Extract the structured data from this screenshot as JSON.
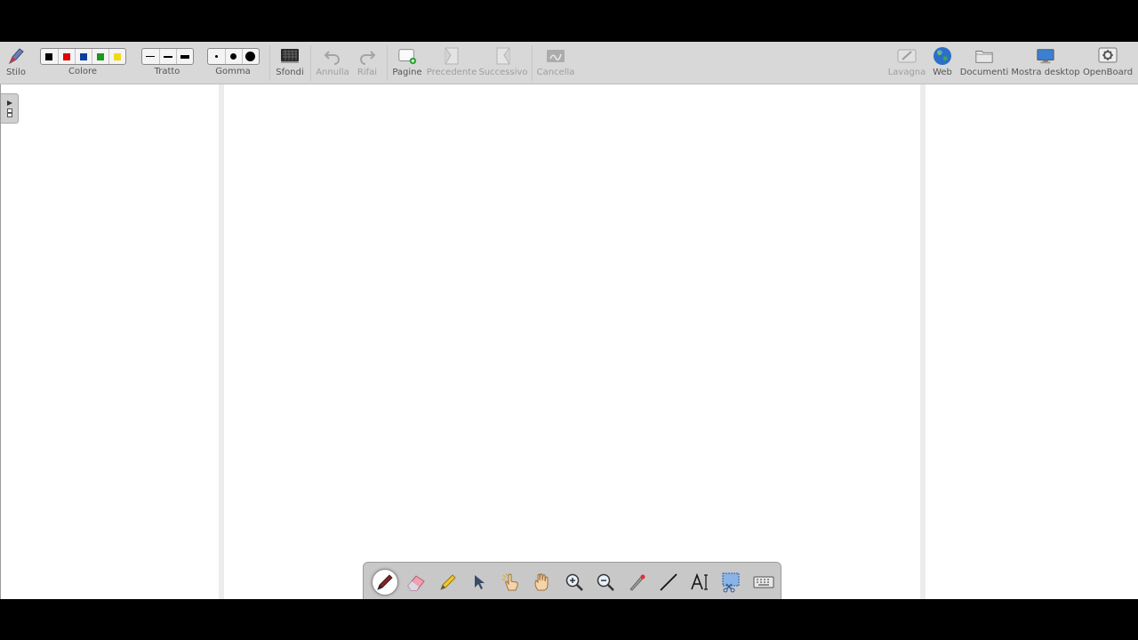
{
  "toolbar": {
    "stylus_label": "Stilo",
    "color_label": "Colore",
    "colors": [
      "#000000",
      "#e00000",
      "#0a3fa0",
      "#1a9a1a",
      "#f2d81a"
    ],
    "stroke_label": "Tratto",
    "eraser_label": "Gomma",
    "backgrounds_label": "Sfondi",
    "undo_label": "Annulla",
    "redo_label": "Rifai",
    "pages_label": "Pagine",
    "previous_label": "Precedente",
    "next_label": "Successivo",
    "clear_label": "Cancella",
    "board_label": "Lavagna",
    "web_label": "Web",
    "documents_label": "Documenti",
    "show_desktop_label": "Mostra desktop",
    "openboard_label": "OpenBoard"
  },
  "palette": {
    "tools": [
      "pen-icon",
      "eraser-icon",
      "marker-icon",
      "selector-icon",
      "interactor-icon",
      "hand-icon",
      "zoom-in-icon",
      "zoom-out-icon",
      "laser-pointer-icon",
      "line-icon",
      "text-icon",
      "capture-icon",
      "keyboard-icon"
    ],
    "active_tool": "pen-icon"
  }
}
